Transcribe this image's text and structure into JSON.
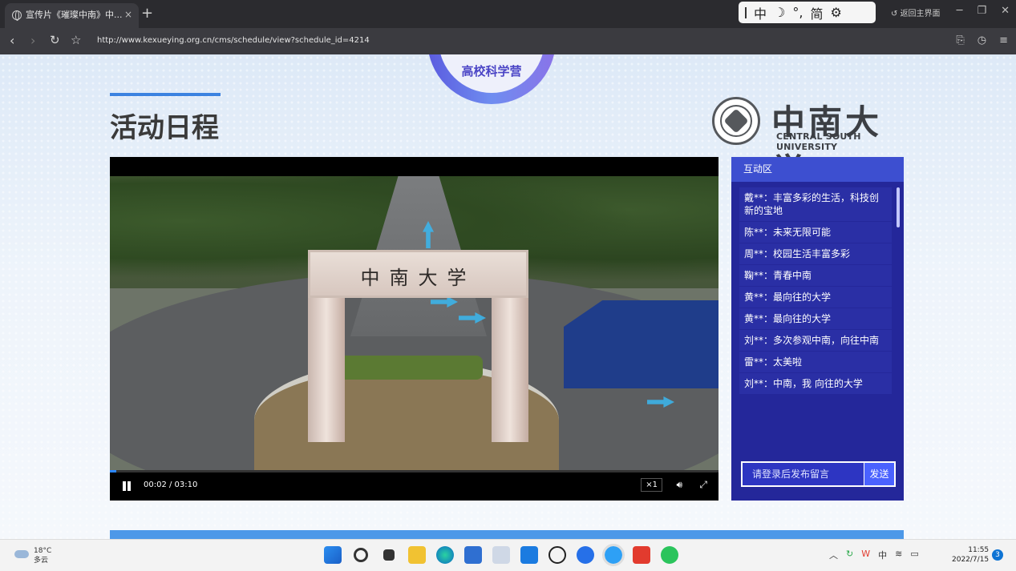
{
  "browser": {
    "tab_title": "宣传片《璀璨中南》中...",
    "tab_close": "×",
    "new_tab": "+",
    "url": "http://www.kexueying.org.cn/cms/schedule/view?schedule_id=4214",
    "back_home": "返回主界面"
  },
  "ime": {
    "items": [
      "中",
      "☽",
      "°,",
      "简",
      "⚙"
    ]
  },
  "page": {
    "badge_text": "高校科学营",
    "title": "活动日程",
    "logo_cn": "中南大学",
    "logo_en": "CENTRAL SOUTH UNIVERSITY"
  },
  "video": {
    "gate_text": "中南大学",
    "time": "00:02 / 03:10",
    "speed": "×1",
    "progress": 0.011
  },
  "chat": {
    "header": "互动区",
    "messages": [
      "戴**：丰富多彩的生活，科技创新的宝地",
      "陈**：未来无限可能",
      "周**：校园生活丰富多彩",
      "鞠**：青春中南",
      "黄**：最向往的大学",
      "黄**：最向往的大学",
      "刘**：多次参观中南，向往中南",
      "雷**：太美啦",
      "刘**：中南，我 向往的大学"
    ],
    "placeholder": "请登录后发布留言",
    "send_label": "发送"
  },
  "taskbar": {
    "temp": "18°C",
    "weather": "多云",
    "tray_lang": "中",
    "time": "11:55",
    "date": "2022/7/15",
    "notification_count": "3"
  }
}
